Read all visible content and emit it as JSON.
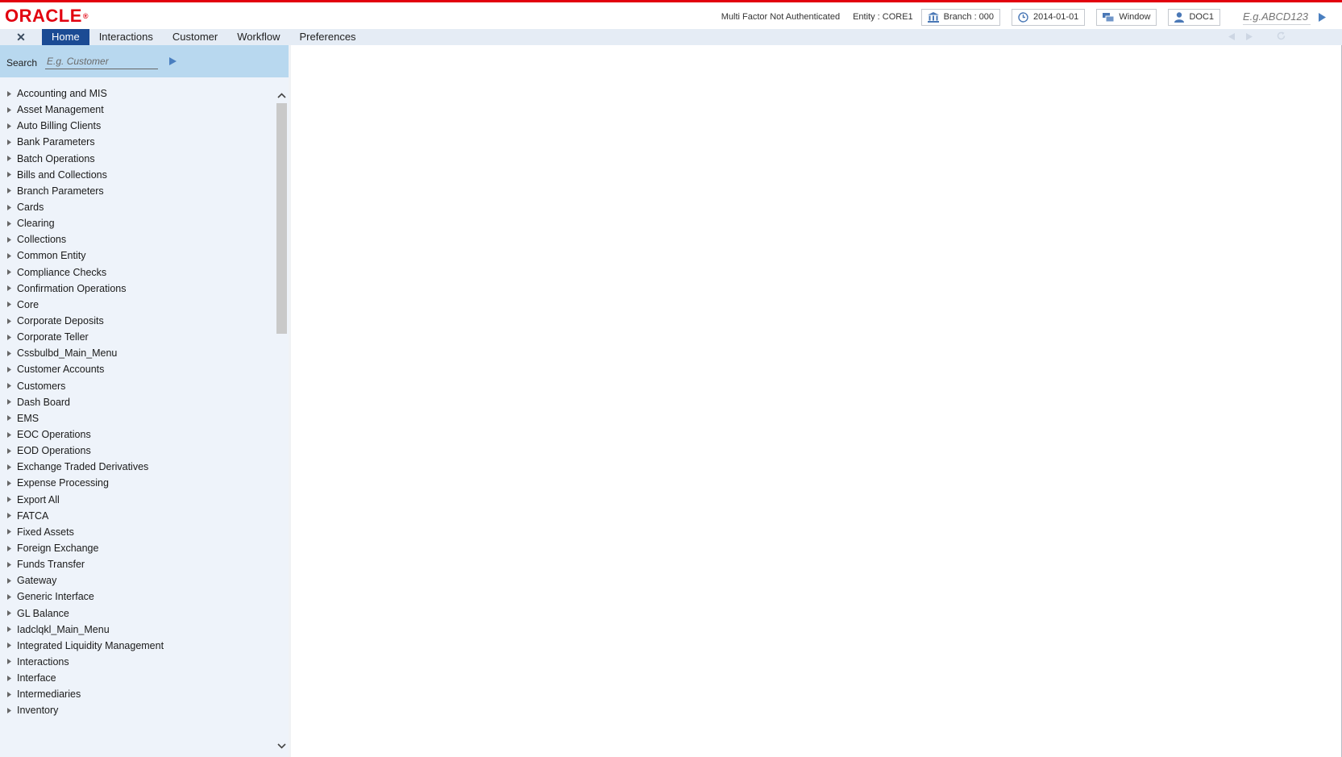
{
  "brand": {
    "logo_text": "ORACLE"
  },
  "header": {
    "mfa_status": "Multi Factor Not Authenticated",
    "entity": "Entity : CORE1",
    "branch_label": "Branch : 000",
    "date_label": "2014-01-01",
    "window_label": "Window",
    "user_label": "DOC1",
    "quick_search_placeholder": "E.g.ABCD123"
  },
  "menubar": {
    "close_glyph": "✕",
    "tabs": [
      {
        "label": "Home",
        "active": true
      },
      {
        "label": "Interactions"
      },
      {
        "label": "Customer"
      },
      {
        "label": "Workflow"
      },
      {
        "label": "Preferences"
      }
    ]
  },
  "sidebar": {
    "search_label": "Search",
    "search_placeholder": "E.g. Customer",
    "items": [
      "Accounting and MIS",
      "Asset Management",
      "Auto Billing Clients",
      "Bank Parameters",
      "Batch Operations",
      "Bills and Collections",
      "Branch Parameters",
      "Cards",
      "Clearing",
      "Collections",
      "Common Entity",
      "Compliance Checks",
      "Confirmation Operations",
      "Core",
      "Corporate Deposits",
      "Corporate Teller",
      "Cssbulbd_Main_Menu",
      "Customer Accounts",
      "Customers",
      "Dash Board",
      "EMS",
      "EOC Operations",
      "EOD Operations",
      "Exchange Traded Derivatives",
      "Expense Processing",
      "Export All",
      "FATCA",
      "Fixed Assets",
      "Foreign Exchange",
      "Funds Transfer",
      "Gateway",
      "Generic Interface",
      "GL Balance",
      "Iadclqkl_Main_Menu",
      "Integrated Liquidity Management",
      "Interactions",
      "Interface",
      "Intermediaries",
      "Inventory"
    ]
  },
  "colors": {
    "brand_red": "#e2000f",
    "active_tab": "#1b4b94",
    "search_band": "#b8d8ef",
    "sidebar_bg": "#eef3fa"
  }
}
